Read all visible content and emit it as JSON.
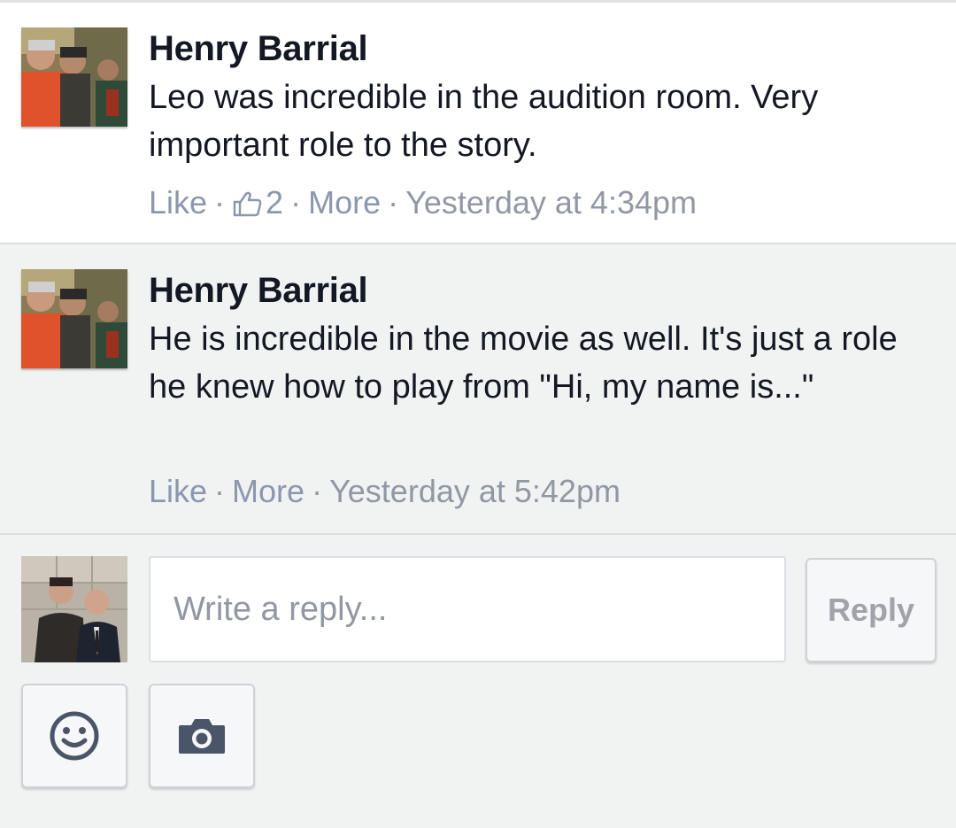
{
  "comments": [
    {
      "author": "Henry Barrial",
      "text": "Leo was incredible in the audition room. Very important role to the story.",
      "like_label": "Like",
      "like_count": "2",
      "more_label": "More",
      "timestamp": "Yesterday at 4:34pm",
      "like_icon": "thumbs-up-icon"
    },
    {
      "author": "Henry Barrial",
      "text": "He is incredible in the movie as well. It's just a role he knew how to play from \"Hi, my name is...\"",
      "like_label": "Like",
      "more_label": "More",
      "timestamp": "Yesterday at 5:42pm"
    }
  ],
  "composer": {
    "placeholder": "Write a reply...",
    "reply_label": "Reply",
    "emoji_icon": "smiley-icon",
    "camera_icon": "camera-icon"
  },
  "colors": {
    "meta_link": "#8a97ae",
    "icon": "#4b5568",
    "text": "#141823"
  }
}
